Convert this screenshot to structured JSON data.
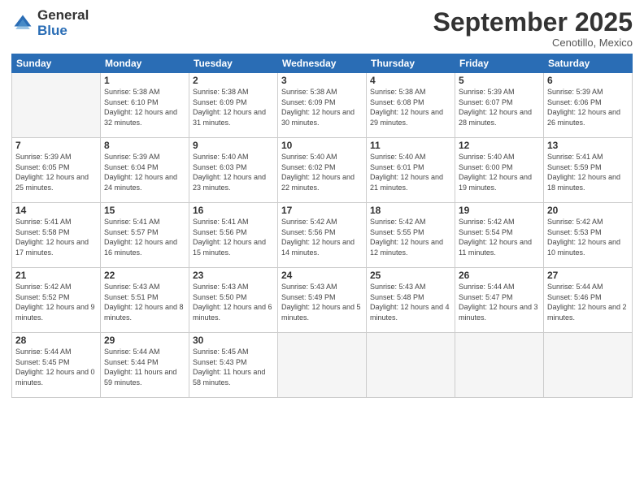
{
  "logo": {
    "general": "General",
    "blue": "Blue"
  },
  "title": "September 2025",
  "location": "Cenotillo, Mexico",
  "days_header": [
    "Sunday",
    "Monday",
    "Tuesday",
    "Wednesday",
    "Thursday",
    "Friday",
    "Saturday"
  ],
  "weeks": [
    [
      {
        "day": "",
        "sunrise": "",
        "sunset": "",
        "daylight": ""
      },
      {
        "day": "1",
        "sunrise": "Sunrise: 5:38 AM",
        "sunset": "Sunset: 6:10 PM",
        "daylight": "Daylight: 12 hours and 32 minutes."
      },
      {
        "day": "2",
        "sunrise": "Sunrise: 5:38 AM",
        "sunset": "Sunset: 6:09 PM",
        "daylight": "Daylight: 12 hours and 31 minutes."
      },
      {
        "day": "3",
        "sunrise": "Sunrise: 5:38 AM",
        "sunset": "Sunset: 6:09 PM",
        "daylight": "Daylight: 12 hours and 30 minutes."
      },
      {
        "day": "4",
        "sunrise": "Sunrise: 5:38 AM",
        "sunset": "Sunset: 6:08 PM",
        "daylight": "Daylight: 12 hours and 29 minutes."
      },
      {
        "day": "5",
        "sunrise": "Sunrise: 5:39 AM",
        "sunset": "Sunset: 6:07 PM",
        "daylight": "Daylight: 12 hours and 28 minutes."
      },
      {
        "day": "6",
        "sunrise": "Sunrise: 5:39 AM",
        "sunset": "Sunset: 6:06 PM",
        "daylight": "Daylight: 12 hours and 26 minutes."
      }
    ],
    [
      {
        "day": "7",
        "sunrise": "Sunrise: 5:39 AM",
        "sunset": "Sunset: 6:05 PM",
        "daylight": "Daylight: 12 hours and 25 minutes."
      },
      {
        "day": "8",
        "sunrise": "Sunrise: 5:39 AM",
        "sunset": "Sunset: 6:04 PM",
        "daylight": "Daylight: 12 hours and 24 minutes."
      },
      {
        "day": "9",
        "sunrise": "Sunrise: 5:40 AM",
        "sunset": "Sunset: 6:03 PM",
        "daylight": "Daylight: 12 hours and 23 minutes."
      },
      {
        "day": "10",
        "sunrise": "Sunrise: 5:40 AM",
        "sunset": "Sunset: 6:02 PM",
        "daylight": "Daylight: 12 hours and 22 minutes."
      },
      {
        "day": "11",
        "sunrise": "Sunrise: 5:40 AM",
        "sunset": "Sunset: 6:01 PM",
        "daylight": "Daylight: 12 hours and 21 minutes."
      },
      {
        "day": "12",
        "sunrise": "Sunrise: 5:40 AM",
        "sunset": "Sunset: 6:00 PM",
        "daylight": "Daylight: 12 hours and 19 minutes."
      },
      {
        "day": "13",
        "sunrise": "Sunrise: 5:41 AM",
        "sunset": "Sunset: 5:59 PM",
        "daylight": "Daylight: 12 hours and 18 minutes."
      }
    ],
    [
      {
        "day": "14",
        "sunrise": "Sunrise: 5:41 AM",
        "sunset": "Sunset: 5:58 PM",
        "daylight": "Daylight: 12 hours and 17 minutes."
      },
      {
        "day": "15",
        "sunrise": "Sunrise: 5:41 AM",
        "sunset": "Sunset: 5:57 PM",
        "daylight": "Daylight: 12 hours and 16 minutes."
      },
      {
        "day": "16",
        "sunrise": "Sunrise: 5:41 AM",
        "sunset": "Sunset: 5:56 PM",
        "daylight": "Daylight: 12 hours and 15 minutes."
      },
      {
        "day": "17",
        "sunrise": "Sunrise: 5:42 AM",
        "sunset": "Sunset: 5:56 PM",
        "daylight": "Daylight: 12 hours and 14 minutes."
      },
      {
        "day": "18",
        "sunrise": "Sunrise: 5:42 AM",
        "sunset": "Sunset: 5:55 PM",
        "daylight": "Daylight: 12 hours and 12 minutes."
      },
      {
        "day": "19",
        "sunrise": "Sunrise: 5:42 AM",
        "sunset": "Sunset: 5:54 PM",
        "daylight": "Daylight: 12 hours and 11 minutes."
      },
      {
        "day": "20",
        "sunrise": "Sunrise: 5:42 AM",
        "sunset": "Sunset: 5:53 PM",
        "daylight": "Daylight: 12 hours and 10 minutes."
      }
    ],
    [
      {
        "day": "21",
        "sunrise": "Sunrise: 5:42 AM",
        "sunset": "Sunset: 5:52 PM",
        "daylight": "Daylight: 12 hours and 9 minutes."
      },
      {
        "day": "22",
        "sunrise": "Sunrise: 5:43 AM",
        "sunset": "Sunset: 5:51 PM",
        "daylight": "Daylight: 12 hours and 8 minutes."
      },
      {
        "day": "23",
        "sunrise": "Sunrise: 5:43 AM",
        "sunset": "Sunset: 5:50 PM",
        "daylight": "Daylight: 12 hours and 6 minutes."
      },
      {
        "day": "24",
        "sunrise": "Sunrise: 5:43 AM",
        "sunset": "Sunset: 5:49 PM",
        "daylight": "Daylight: 12 hours and 5 minutes."
      },
      {
        "day": "25",
        "sunrise": "Sunrise: 5:43 AM",
        "sunset": "Sunset: 5:48 PM",
        "daylight": "Daylight: 12 hours and 4 minutes."
      },
      {
        "day": "26",
        "sunrise": "Sunrise: 5:44 AM",
        "sunset": "Sunset: 5:47 PM",
        "daylight": "Daylight: 12 hours and 3 minutes."
      },
      {
        "day": "27",
        "sunrise": "Sunrise: 5:44 AM",
        "sunset": "Sunset: 5:46 PM",
        "daylight": "Daylight: 12 hours and 2 minutes."
      }
    ],
    [
      {
        "day": "28",
        "sunrise": "Sunrise: 5:44 AM",
        "sunset": "Sunset: 5:45 PM",
        "daylight": "Daylight: 12 hours and 0 minutes."
      },
      {
        "day": "29",
        "sunrise": "Sunrise: 5:44 AM",
        "sunset": "Sunset: 5:44 PM",
        "daylight": "Daylight: 11 hours and 59 minutes."
      },
      {
        "day": "30",
        "sunrise": "Sunrise: 5:45 AM",
        "sunset": "Sunset: 5:43 PM",
        "daylight": "Daylight: 11 hours and 58 minutes."
      },
      {
        "day": "",
        "sunrise": "",
        "sunset": "",
        "daylight": ""
      },
      {
        "day": "",
        "sunrise": "",
        "sunset": "",
        "daylight": ""
      },
      {
        "day": "",
        "sunrise": "",
        "sunset": "",
        "daylight": ""
      },
      {
        "day": "",
        "sunrise": "",
        "sunset": "",
        "daylight": ""
      }
    ]
  ]
}
